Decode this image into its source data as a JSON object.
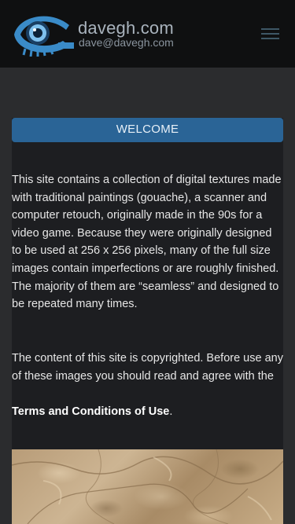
{
  "header": {
    "site_name": "davegh.com",
    "site_email": "dave@davegh.com",
    "logo_icon": "eye-logo-icon",
    "menu_icon": "hamburger-menu-icon"
  },
  "main": {
    "welcome_heading": "WELCOME",
    "paragraph1": "This site contains a collection of digital textures made with traditional paintings (gouache), a scanner and computer retouch, originally made in the 90s for a video game. Because they were originally designed to be used at 256 x 256 pixels, many of the full size images contain imperfections or are roughly finished. The majority of them are “seamless” and designed to be repeated many times.",
    "paragraph2": "The content of this site is copyrighted. Before use any of these images you should read and agree with the",
    "terms_link": "Terms and Conditions of Use",
    "terms_period": "."
  },
  "colors": {
    "header_bg": "#0f1011",
    "page_bg": "#2b2c2e",
    "content_bg": "#1d1e21",
    "welcome_bg": "#2a6496",
    "logo_blue": "#3a8bc8"
  }
}
